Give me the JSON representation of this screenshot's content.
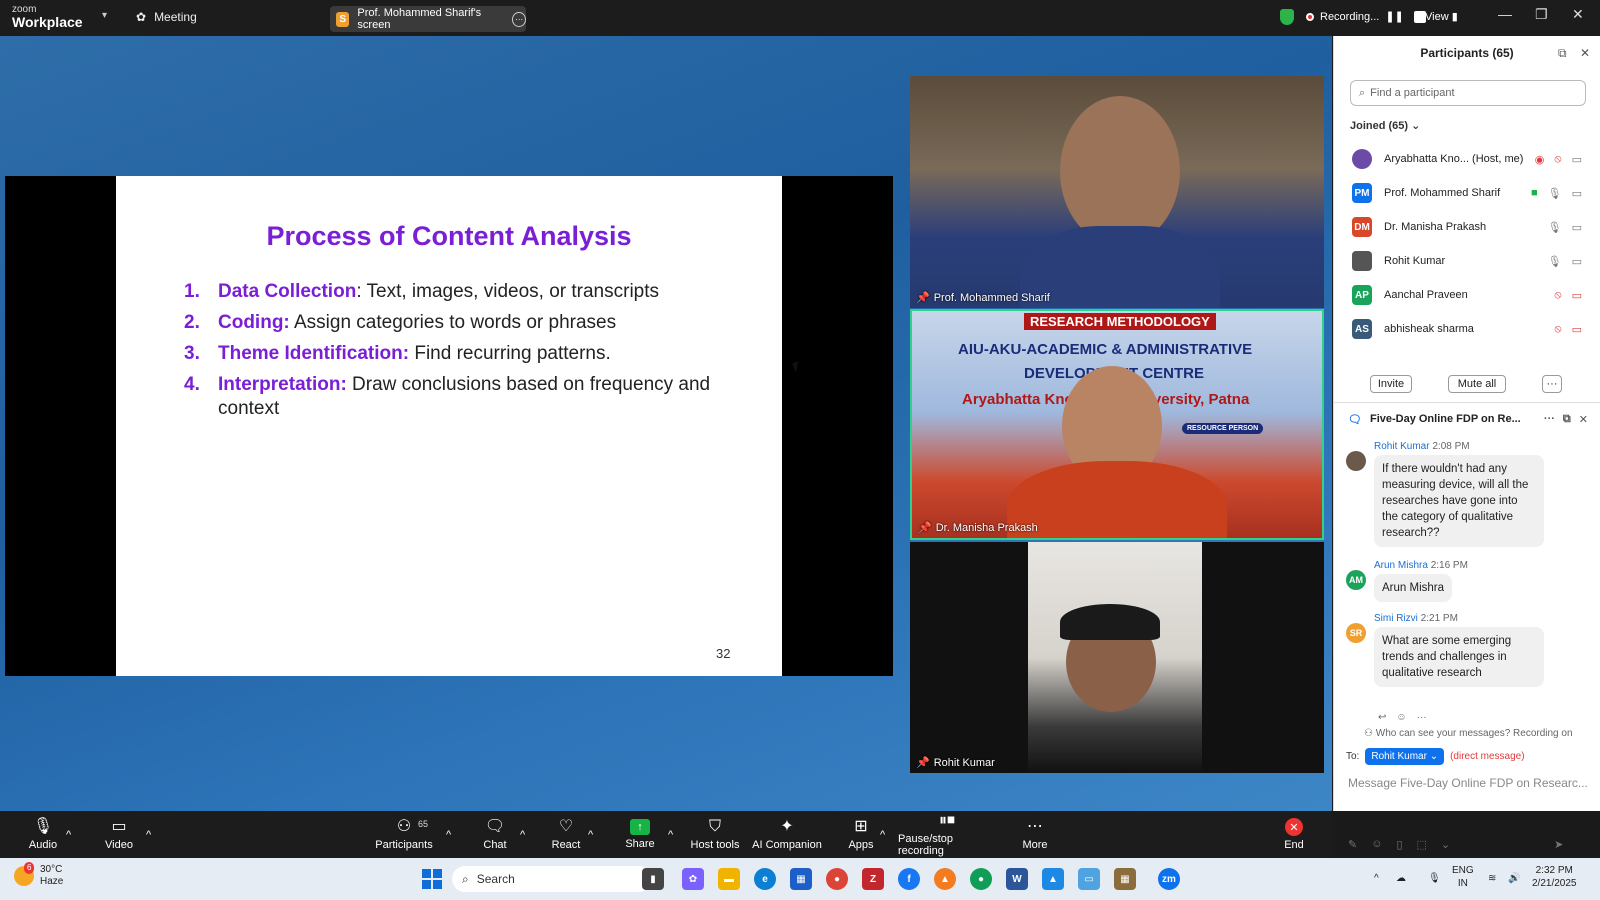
{
  "topbar": {
    "logo_small": "zoom",
    "logo_big": "Workplace",
    "meeting_label": "Meeting",
    "screen_badge": "S",
    "screen_label": "Prof. Mohammed Sharif's screen",
    "recording_label": "Recording...",
    "view_label": "View"
  },
  "slide": {
    "title": "Process of Content Analysis",
    "items": [
      {
        "num": "1.",
        "term": "Data Collection",
        "rest": ": Text, images, videos, or transcripts"
      },
      {
        "num": "2.",
        "term": "Coding:",
        "rest": " Assign categories to words or phrases"
      },
      {
        "num": "3.",
        "term": "Theme Identification:",
        "rest": " Find recurring patterns."
      },
      {
        "num": "4.",
        "term": "Interpretation:",
        "rest": " Draw conclusions based on frequency and context"
      }
    ],
    "page": "32"
  },
  "tiles": {
    "t1_name": "Prof. Mohammed Sharif",
    "t2_name": "Dr. Manisha Prakash",
    "t3_name": "Rohit Kumar",
    "banner_top": "RESEARCH METHODOLOGY",
    "banner_line1": "AIU-AKU-ACADEMIC & ADMINISTRATIVE",
    "banner_line2": "DEVELOPMENT CENTRE",
    "banner_line3": "Aryabhatta Knowledge University, Patna",
    "banner_chip": "RESOURCE PERSON"
  },
  "participants": {
    "header": "Participants (65)",
    "search_placeholder": "Find a participant",
    "joined": "Joined (65)",
    "list": [
      {
        "initials": "",
        "name": "Aryabhatta Kno...  (Host, me)",
        "color": "#6b4aa8"
      },
      {
        "initials": "PM",
        "name": "Prof. Mohammed Sharif",
        "color": "#0e72ed"
      },
      {
        "initials": "DM",
        "name": "Dr. Manisha Prakash",
        "color": "#d9472b"
      },
      {
        "initials": "",
        "name": "Rohit Kumar",
        "color": "#555555"
      },
      {
        "initials": "AP",
        "name": "Aanchal Praveen",
        "color": "#1aa35a"
      },
      {
        "initials": "AS",
        "name": "abhisheak sharma",
        "color": "#3a5a7a"
      }
    ],
    "invite_label": "Invite",
    "mute_all_label": "Mute all",
    "more_label": "···"
  },
  "chat": {
    "title": "Five-Day Online FDP on Re...",
    "messages": [
      {
        "initials": "",
        "name": "Rohit Kumar",
        "time": "2:08 PM",
        "text": "If there wouldn't had any measuring device, will all the researches have gone into the category of qualitative research??",
        "color": "#6b5a4a"
      },
      {
        "initials": "AM",
        "name": "Arun Mishra",
        "time": "2:16 PM",
        "text": "Arun Mishra",
        "color": "#1aa35a"
      },
      {
        "initials": "SR",
        "name": "Simi Rizvi",
        "time": "2:21 PM",
        "text": "What are some emerging trends and challenges in qualitative research",
        "color": "#f0a030"
      }
    ],
    "who_label": "Who can see your messages? Recording on",
    "to_label": "To:",
    "to_chip": "Rohit Kumar ⌄",
    "direct_label": "(direct message)",
    "input_placeholder": "Message Five-Day Online FDP on Researc..."
  },
  "toolbar": {
    "audio": "Audio",
    "video": "Video",
    "participants": "Participants",
    "participants_count": "65",
    "chat": "Chat",
    "react": "React",
    "share": "Share",
    "host_tools": "Host tools",
    "ai_companion": "AI Companion",
    "apps": "Apps",
    "pause_rec": "Pause/stop recording",
    "more": "More",
    "end": "End"
  },
  "taskbar": {
    "weather_badge": "6",
    "temp": "30°C",
    "condition": "Haze",
    "search": "Search",
    "lang1": "ENG",
    "lang2": "IN",
    "time": "2:32 PM",
    "date": "2/21/2025"
  },
  "colors": {
    "accent_purple": "#7a1fd6",
    "zoom_blue": "#0e72ed",
    "speaking_border": "#2fd28a",
    "end_red": "#e33333"
  }
}
